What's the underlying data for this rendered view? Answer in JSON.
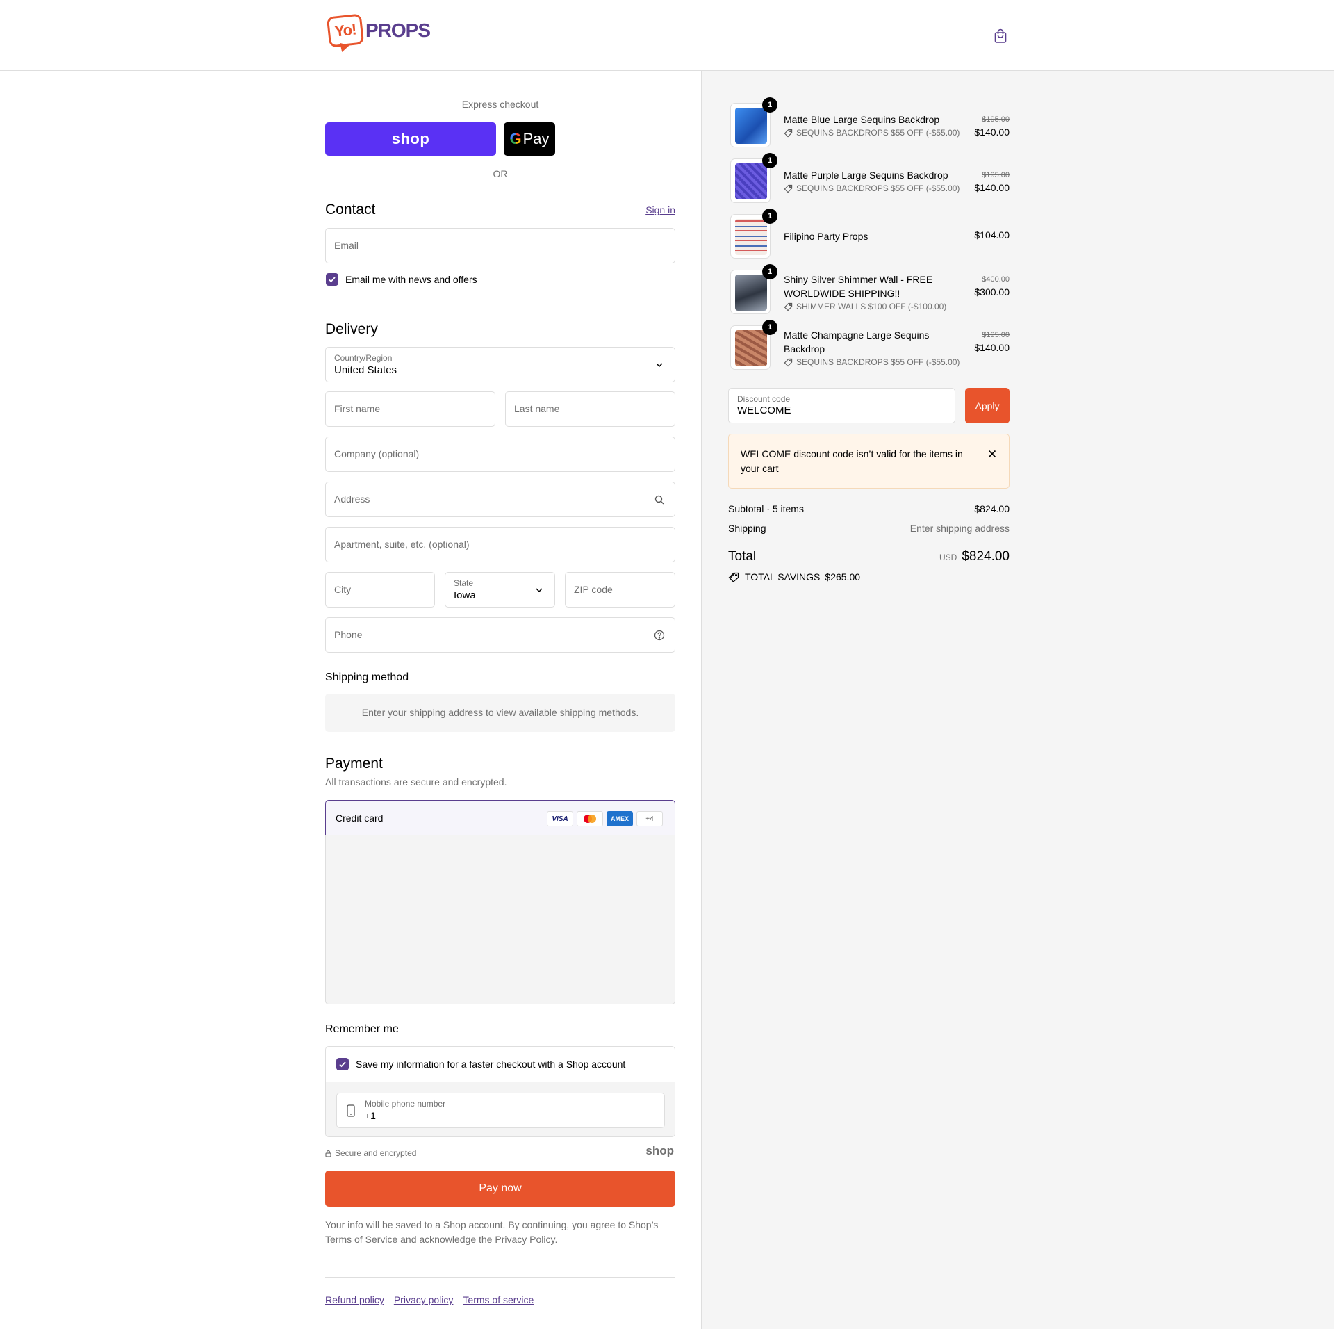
{
  "header": {
    "logo_yo": "Yo!",
    "logo_props": "PROPS",
    "cart_icon": "bag-icon"
  },
  "express": {
    "title": "Express checkout",
    "shop_label": "shop",
    "gpay_g": "G",
    "gpay_label": "Pay",
    "or_label": "OR"
  },
  "contact": {
    "title": "Contact",
    "sign_in": "Sign in",
    "email_placeholder": "Email",
    "newsletter_label": "Email me with news and offers"
  },
  "delivery": {
    "title": "Delivery",
    "country_label": "Country/Region",
    "country_value": "United States",
    "first_name": "First name",
    "last_name": "Last name",
    "company": "Company (optional)",
    "address": "Address",
    "apartment": "Apartment, suite, etc. (optional)",
    "city": "City",
    "state_label": "State",
    "state_value": "Iowa",
    "zip": "ZIP code",
    "phone": "Phone"
  },
  "shipping": {
    "title": "Shipping method",
    "message": "Enter your shipping address to view available shipping methods."
  },
  "payment": {
    "title": "Payment",
    "subtitle": "All transactions are secure and encrypted.",
    "method": "Credit card",
    "cards": [
      "VISA",
      "MC",
      "AMEX",
      "+4"
    ]
  },
  "remember": {
    "title": "Remember me",
    "save_label": "Save my information for a faster checkout with a Shop account",
    "phone_label": "Mobile phone number",
    "phone_value": "+1",
    "secure": "Secure and encrypted",
    "shop_brand": "shop"
  },
  "pay_button": "Pay now",
  "legal": {
    "text1": "Your info will be saved to a Shop account. By continuing, you agree to Shop’s",
    "tos": "Terms of Service",
    "text2": "and acknowledge the",
    "privacy": "Privacy Policy",
    "end": "."
  },
  "footer": {
    "refund": "Refund policy",
    "privacy": "Privacy policy",
    "terms": "Terms of service"
  },
  "summary": {
    "items": [
      {
        "name": "Matte Blue Large Sequins Backdrop",
        "discount": "SEQUINS BACKDROPS $55 OFF (-$55.00)",
        "old_price": "$195.00",
        "price": "$140.00",
        "qty": "1",
        "color": "#2b6fd6"
      },
      {
        "name": "Matte Purple Large Sequins Backdrop",
        "discount": "SEQUINS BACKDROPS $55 OFF (-$55.00)",
        "old_price": "$195.00",
        "price": "$140.00",
        "qty": "1",
        "color": "#5a4cc7"
      },
      {
        "name": "Filipino Party Props",
        "discount": "",
        "old_price": "",
        "price": "$104.00",
        "qty": "1",
        "color": "#f2e9e4"
      },
      {
        "name": "Shiny Silver Shimmer Wall - FREE",
        "name2": "WORLDWIDE SHIPPING!!",
        "discount": "SHIMMER WALLS $100 OFF (-$100.00)",
        "old_price": "$400.00",
        "price": "$300.00",
        "qty": "1",
        "color": "#5a6270"
      },
      {
        "name": "Matte Champagne Large Sequins",
        "name2": "Backdrop",
        "discount": "SEQUINS BACKDROPS $55 OFF (-$55.00)",
        "old_price": "$195.00",
        "price": "$140.00",
        "qty": "1",
        "color": "#b9735a"
      }
    ],
    "discount_label": "Discount code",
    "discount_value": "WELCOME",
    "apply": "Apply",
    "alert": "WELCOME discount code isn’t valid for the items in your cart",
    "subtotal_label": "Subtotal · 5 items",
    "subtotal_value": "$824.00",
    "shipping_label": "Shipping",
    "shipping_value": "Enter shipping address",
    "total_label": "Total",
    "currency": "USD",
    "total_value": "$824.00",
    "savings_label": "TOTAL SAVINGS",
    "savings_value": "$265.00"
  },
  "colors": {
    "brand": "#5a3e8e",
    "accent": "#e8542c",
    "shop": "#5a31f4"
  }
}
